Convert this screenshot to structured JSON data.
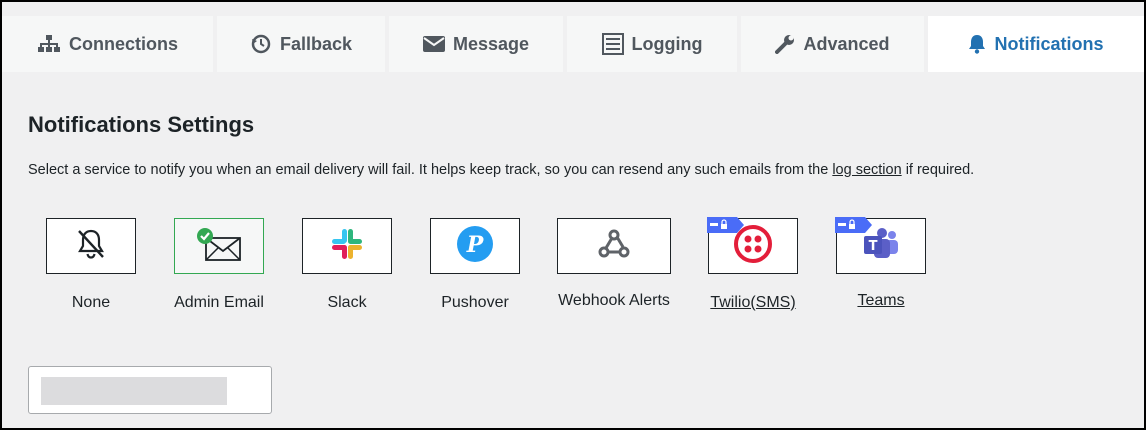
{
  "tabs": [
    {
      "label": "Connections",
      "icon": "sitemap-icon"
    },
    {
      "label": "Fallback",
      "icon": "history-icon"
    },
    {
      "label": "Message",
      "icon": "envelope-icon"
    },
    {
      "label": "Logging",
      "icon": "list-icon"
    },
    {
      "label": "Advanced",
      "icon": "wrench-icon"
    },
    {
      "label": "Notifications",
      "icon": "bell-icon",
      "active": true
    }
  ],
  "section": {
    "title": "Notifications Settings",
    "desc_before": "Select a service to notify you when an email delivery will fail. It helps keep track, so you can resend any such emails from the",
    "desc_link": "log section",
    "desc_after": "if required."
  },
  "services": [
    {
      "label": "None",
      "icon": "bell-slash-icon"
    },
    {
      "label": "Admin Email",
      "icon": "envelope-check-icon",
      "selected": true
    },
    {
      "label": "Slack",
      "icon": "slack-icon"
    },
    {
      "label": "Pushover",
      "icon": "pushover-icon"
    },
    {
      "label": "Webhook Alerts",
      "icon": "webhook-icon"
    },
    {
      "label": "Twilio(SMS)",
      "icon": "twilio-icon",
      "pro": true
    },
    {
      "label": "Teams",
      "icon": "teams-icon",
      "pro": true
    }
  ],
  "colors": {
    "accent": "#2271b1",
    "selected_border": "#33a852",
    "pro_badge": "#4a6cf7",
    "twilio": "#e31e3a",
    "teams": "#5b5fc7",
    "pushover": "#249df1"
  }
}
